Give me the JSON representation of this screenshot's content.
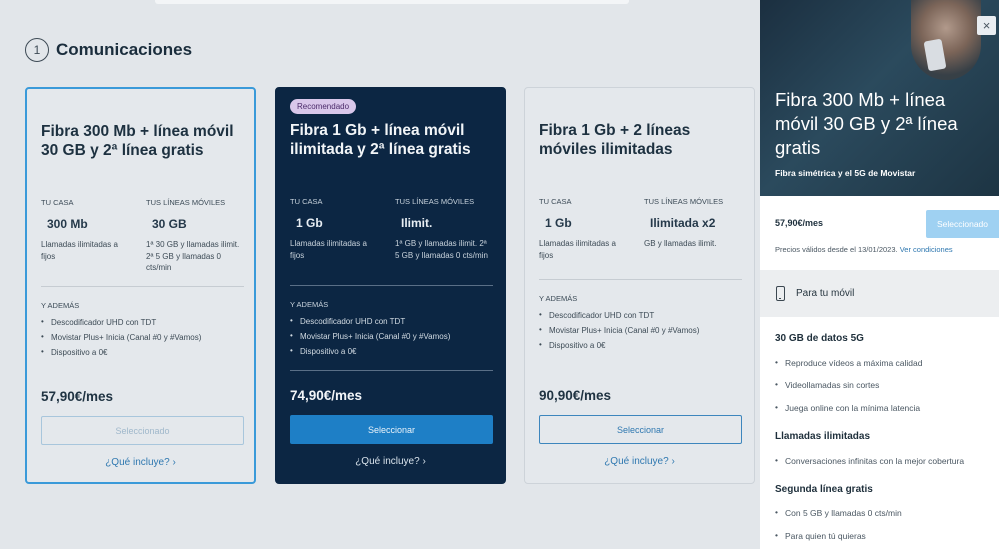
{
  "section": {
    "step": "1",
    "title": "Comunicaciones"
  },
  "cards": [
    {
      "badge": "",
      "title": "Fibra 300 Mb + línea móvil 30 GB y 2ª línea gratis",
      "home_label": "TU CASA",
      "mobile_label": "TUS LÍNEAS MÓVILES",
      "home_value": "300 Mb",
      "mobile_value": "30 GB",
      "home_desc": "Llamadas ilimitadas a fijos",
      "mobile_desc": "1ª 30 GB y llamadas ilimit. 2ª 5 GB y llamadas 0 cts/min",
      "extras_label": "Y ADEMÁS",
      "extras": [
        "Descodificador UHD con TDT",
        "Movistar Plus+ Inicia (Canal #0 y #Vamos)",
        "Dispositivo a 0€"
      ],
      "price": "57,90€/mes",
      "button": "Seleccionado",
      "link": "¿Qué incluye? ›"
    },
    {
      "badge": "Recomendado",
      "title": "Fibra 1 Gb + línea móvil ilimitada y 2ª línea gratis",
      "home_label": "TU CASA",
      "mobile_label": "TUS LÍNEAS MÓVILES",
      "home_value": "1 Gb",
      "mobile_value": "Ilimit.",
      "home_desc": "Llamadas ilimitadas a fijos",
      "mobile_desc": "1ª GB y llamadas ilimit. 2ª 5 GB y llamadas 0 cts/min",
      "extras_label": "Y ADEMÁS",
      "extras": [
        "Descodificador UHD con TDT",
        "Movistar Plus+ Inicia (Canal #0 y #Vamos)",
        "Dispositivo a 0€"
      ],
      "price": "74,90€/mes",
      "button": "Seleccionar",
      "link": "¿Qué incluye? ›"
    },
    {
      "badge": "",
      "title": "Fibra 1 Gb + 2 líneas móviles ilimitadas",
      "home_label": "TU CASA",
      "mobile_label": "TUS LÍNEAS MÓVILES",
      "home_value": "1 Gb",
      "mobile_value": "Ilimitada x2",
      "home_desc": "Llamadas ilimitadas a fijos",
      "mobile_desc": "GB y llamadas ilimit.",
      "extras_label": "Y ADEMÁS",
      "extras": [
        "Descodificador UHD con TDT",
        "Movistar Plus+ Inicia (Canal #0 y #Vamos)",
        "Dispositivo a 0€"
      ],
      "price": "90,90€/mes",
      "button": "Seleccionar",
      "link": "¿Qué incluye? ›"
    }
  ],
  "drawer": {
    "close": "×",
    "title": "Fibra 300 Mb + línea móvil 30 GB y 2ª línea gratis",
    "subtitle": "Fibra simétrica y el 5G de Movistar",
    "price": "57,90€/mes",
    "button": "Seleccionado",
    "valid_text": "Precios válidos desde el 13/01/2023.",
    "valid_link": "Ver condiciones",
    "mobile_section": "Para tu móvil",
    "sections": [
      {
        "title": "30 GB de datos 5G",
        "items": [
          "Reproduce vídeos a máxima calidad",
          "Videollamadas sin cortes",
          "Juega online con la mínima latencia"
        ]
      },
      {
        "title": "Llamadas ilimitadas",
        "items": [
          "Conversaciones infinitas con la mejor cobertura"
        ]
      },
      {
        "title": "Segunda línea gratis",
        "items": [
          "Con 5 GB y llamadas 0 cts/min",
          "Para quien tú quieras"
        ]
      }
    ]
  },
  "colors": {
    "accent": "#1e7fc6",
    "dark_card": "#0c2643",
    "selected_border": "#3a9ad9",
    "badge": "#d9c7ea"
  }
}
